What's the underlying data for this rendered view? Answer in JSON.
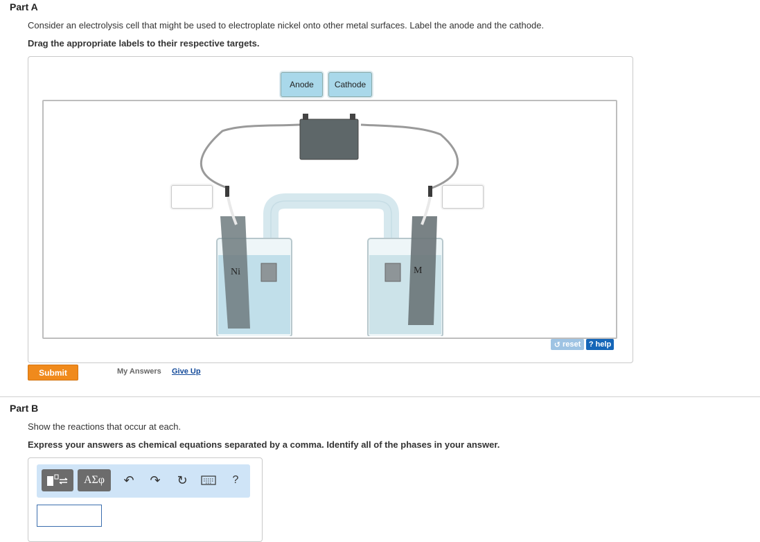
{
  "part_a": {
    "title": "Part A",
    "prompt": "Consider an electrolysis cell that might be used to electroplate nickel onto other metal surfaces. Label the anode and the cathode.",
    "instruction": "Drag the appropriate labels to their respective targets.",
    "labels": [
      "Anode",
      "Cathode"
    ],
    "electrodes": {
      "left": "Ni",
      "right": "M"
    },
    "reset_label": "reset",
    "help_label": "help",
    "submit_label": "Submit",
    "my_answers_label": "My Answers",
    "give_up_label": "Give Up"
  },
  "part_b": {
    "title": "Part B",
    "prompt": "Show the reactions that occur at each.",
    "instruction": "Express your answers as chemical equations separated by a comma. Identify all of the phases in your answer.",
    "toolbar": {
      "templates_icon": "templates-icon",
      "symbols_label": "ΑΣφ",
      "undo_icon": "undo-icon",
      "redo_icon": "redo-icon",
      "reset_icon": "reset-icon",
      "keyboard_icon": "keyboard-icon",
      "help_label": "?"
    },
    "answer_value": ""
  }
}
